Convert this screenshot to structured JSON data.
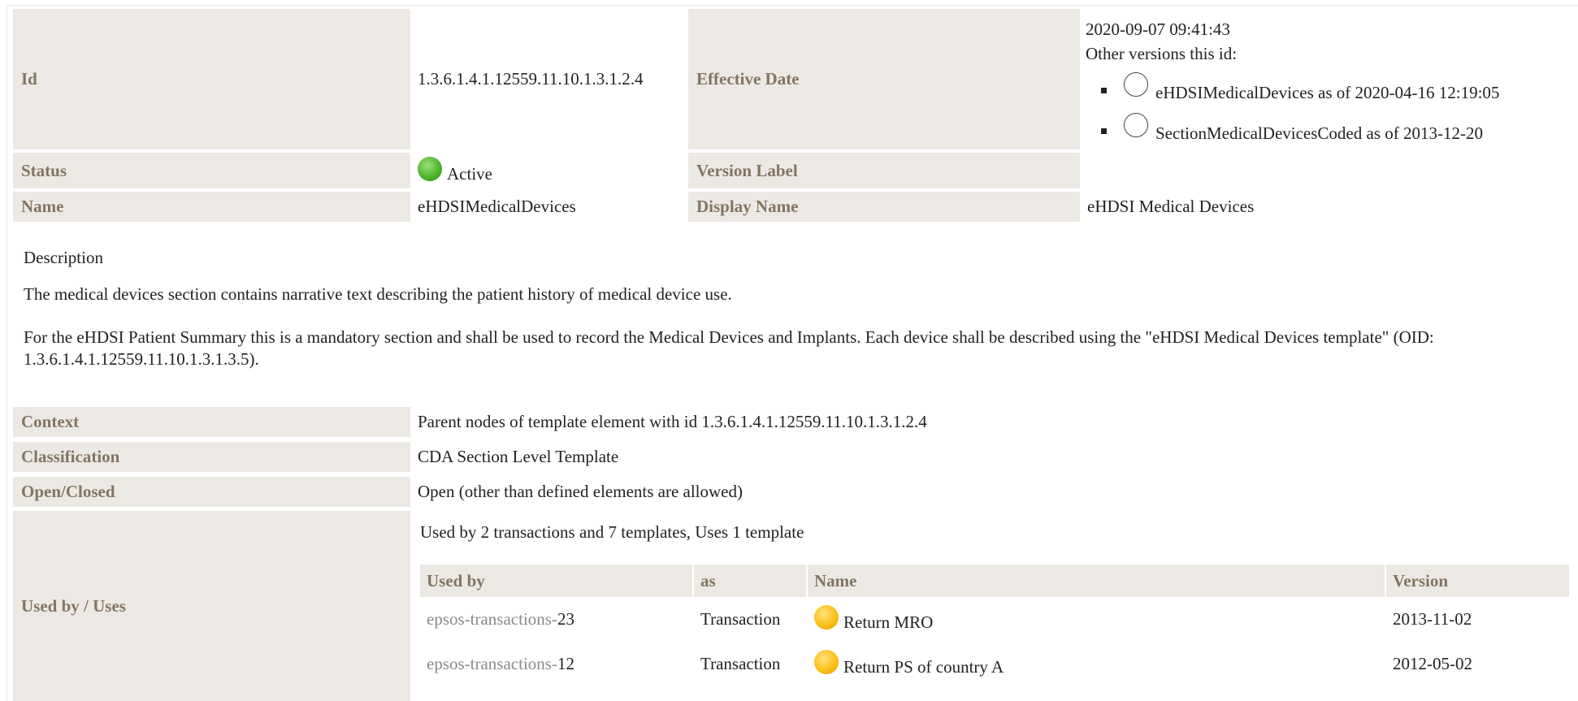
{
  "rows": {
    "id": {
      "label": "Id",
      "value": "1.3.6.1.4.1.12559.11.10.1.3.1.2.4"
    },
    "effective_date": {
      "label": "Effective Date",
      "date": "2020-09-07 09:41:43",
      "other_versions_label": "Other versions this id:",
      "versions": [
        {
          "text": "eHDSIMedicalDevices as of 2020-04-16 12:19:05"
        },
        {
          "text": "SectionMedicalDevicesCoded as of 2013-12-20"
        }
      ]
    },
    "status": {
      "label": "Status",
      "value": "Active",
      "status_color": "#4fb52c"
    },
    "version_label": {
      "label": "Version Label",
      "value": ""
    },
    "name": {
      "label": "Name",
      "value": "eHDSIMedicalDevices"
    },
    "display_name": {
      "label": "Display Name",
      "value": "eHDSI Medical Devices"
    }
  },
  "description": {
    "heading": "Description",
    "paragraphs": [
      "The medical devices section contains narrative text describing the patient history of medical device use.",
      "For the eHDSI Patient Summary this is a mandatory section and shall be used to record the Medical Devices and Implants. Each device shall be described using the \"eHDSI Medical Devices template\" (OID: 1.3.6.1.4.1.12559.11.10.1.3.1.3.5)."
    ]
  },
  "meta": {
    "context": {
      "label": "Context",
      "value": "Parent nodes of template element with id 1.3.6.1.4.1.12559.11.10.1.3.1.2.4"
    },
    "classification": {
      "label": "Classification",
      "value": "CDA Section Level Template"
    },
    "open_closed": {
      "label": "Open/Closed",
      "value": "Open (other than defined elements are allowed)"
    },
    "used_by": {
      "label": "Used by / Uses",
      "summary": "Used by 2 transactions and 7 templates, Uses 1 template"
    }
  },
  "used_by_table": {
    "headers": [
      "Used by",
      "as",
      "Name",
      "Version"
    ],
    "rows": [
      {
        "prefix": "epsos-transactions-",
        "num": "23",
        "as": "Transaction",
        "name": "Return MRO",
        "version": "2013-11-02"
      },
      {
        "prefix": "epsos-transactions-",
        "num": "12",
        "as": "Transaction",
        "name": "Return PS of country A",
        "version": "2012-05-02"
      }
    ]
  },
  "colors": {
    "label_bg": "#ece9e4",
    "label_text": "#837561",
    "status_active": "#4fb52c",
    "status_draft": "#fbbf18"
  }
}
